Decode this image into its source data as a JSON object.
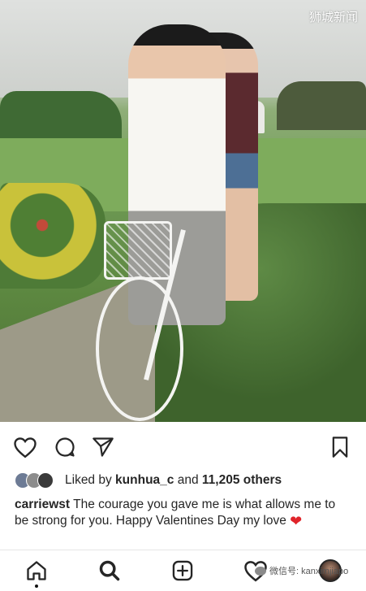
{
  "watermark": "狮城新闻",
  "post": {
    "likes": {
      "prefix": "Liked by ",
      "user": "kunhua_c",
      "middle": " and ",
      "count": "11,205 others"
    },
    "caption": {
      "username": "carriewst",
      "text": " The courage you gave me is what allows me to be strong for you. Happy Valentines Day my love "
    }
  },
  "wechat_watermark": "微信号: kanximjiapo",
  "icons": {
    "like": "heart-outline-icon",
    "comment": "comment-bubble-icon",
    "share": "paper-plane-icon",
    "save": "bookmark-icon",
    "nav_home": "home-icon",
    "nav_search": "search-icon",
    "nav_add": "add-post-icon",
    "nav_activity": "heart-outline-icon",
    "nav_profile": "profile-avatar-icon"
  },
  "colors": {
    "text": "#262626",
    "heart_emoji": "#e0242a"
  }
}
